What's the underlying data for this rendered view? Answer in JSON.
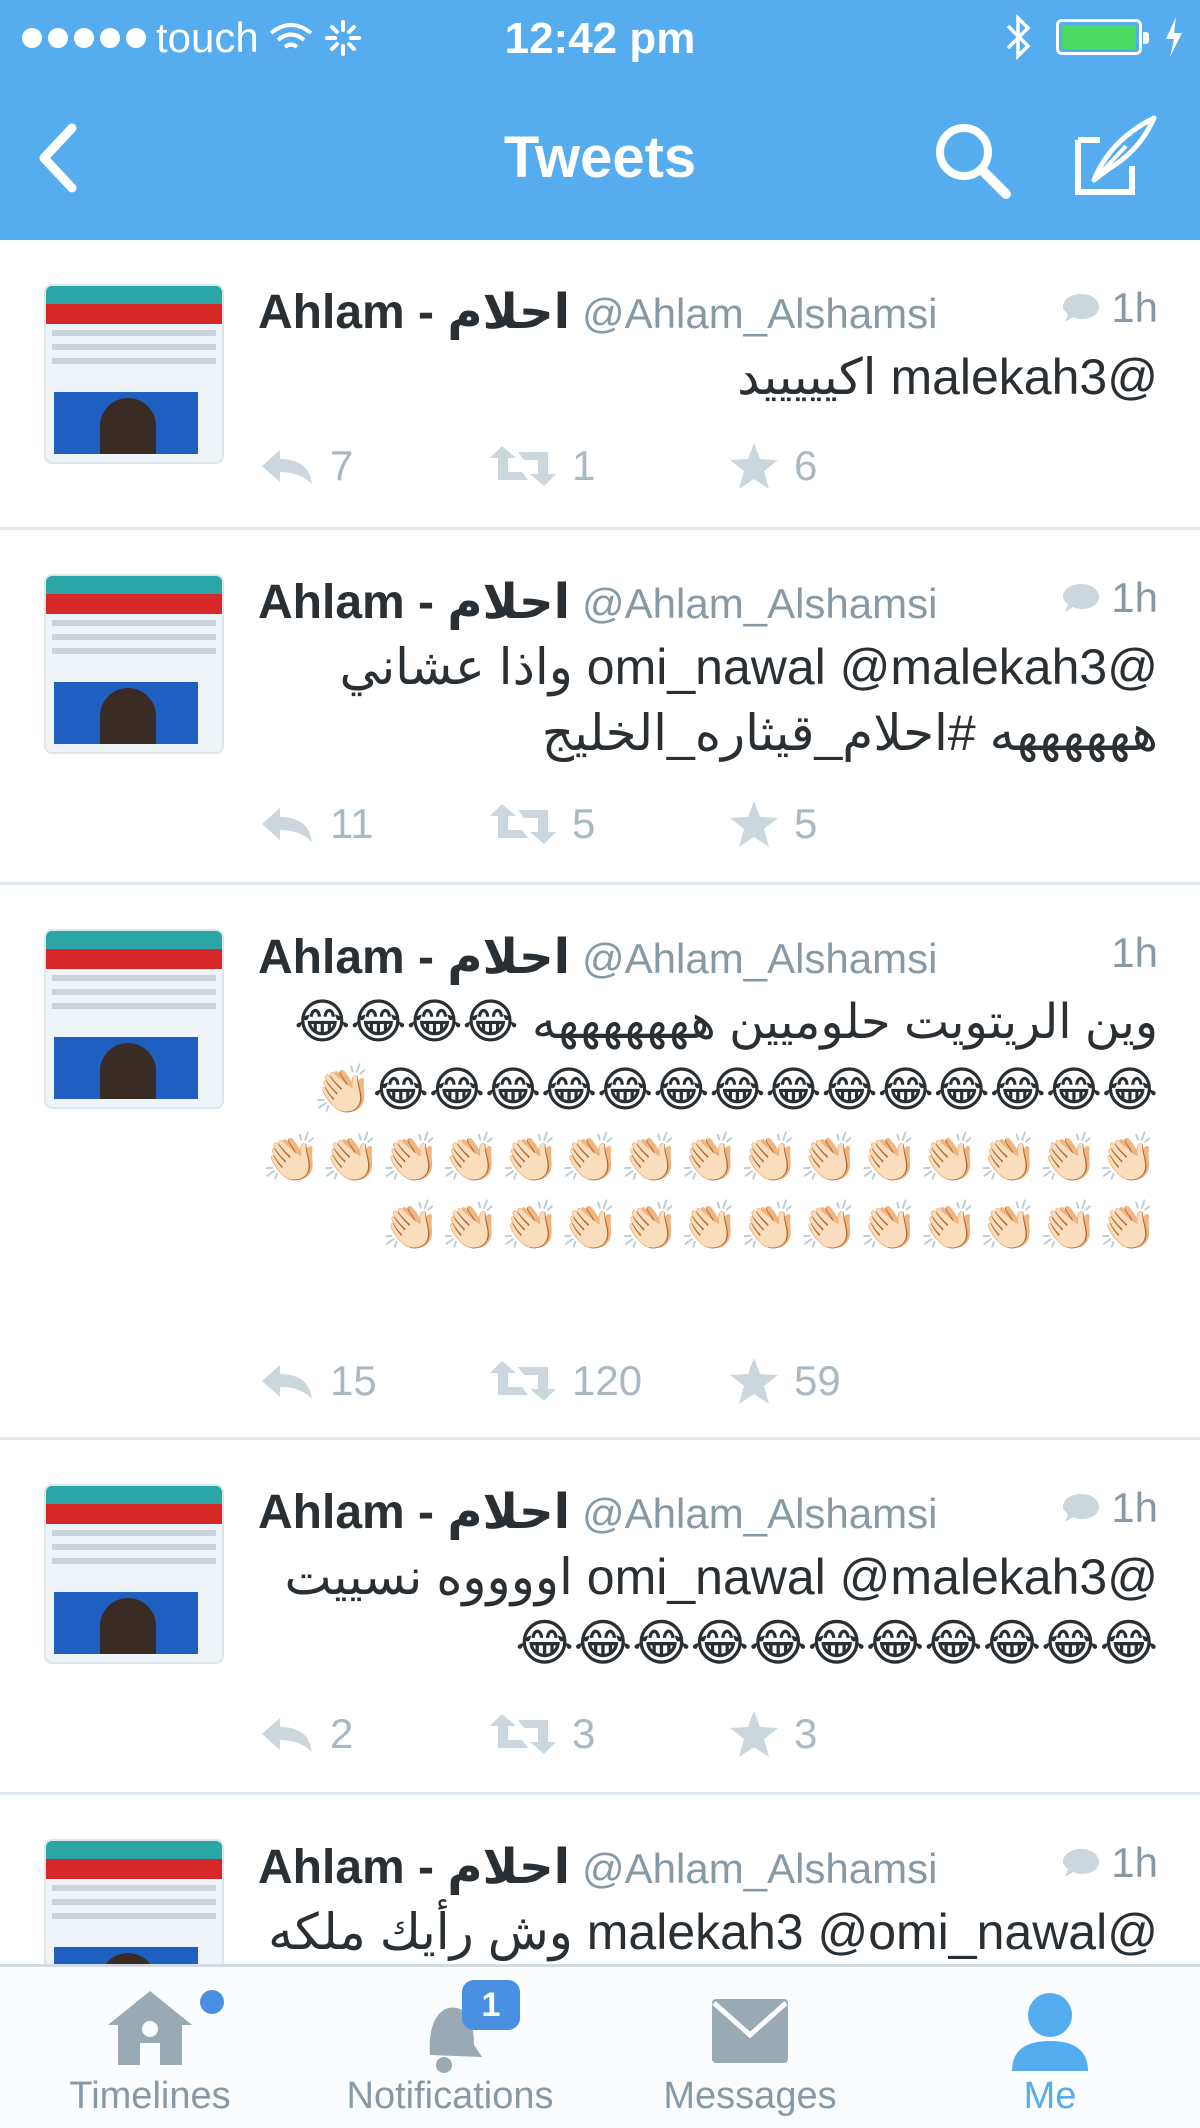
{
  "status_bar": {
    "carrier": "touch",
    "time": "12:42 pm"
  },
  "nav": {
    "title": "Tweets"
  },
  "colors": {
    "brand": "#55acee",
    "divider": "#e1e8ed",
    "muted": "#8899a6"
  },
  "tweets": [
    {
      "name": "Ahlam - احلام",
      "handle": "@Ahlam_Alshamsi",
      "time": "1h",
      "text": "@malekah3 اكيييييد",
      "replies": "7",
      "retweets": "1",
      "favorites": "6"
    },
    {
      "name": "Ahlam - احلام",
      "handle": "@Ahlam_Alshamsi",
      "time": "1h",
      "text": "@omi_nawal @malekah3 واذا عشاني ههههههه #احلام_قيثاره_الخليج",
      "replies": "11",
      "retweets": "5",
      "favorites": "5"
    },
    {
      "name": "Ahlam - احلام",
      "handle": "@Ahlam_Alshamsi",
      "time": "1h",
      "text": "وين الريتويت حلوميين هههههههه 😂😂😂😂😂😂😂😂😂😂😂😂😂😂😂😂😂😂👏🏻👏🏻👏🏻👏🏻👏🏻👏🏻👏🏻👏🏻👏🏻👏🏻👏🏻👏🏻👏🏻👏🏻👏🏻👏🏻👏🏻👏🏻👏🏻👏🏻👏🏻👏🏻👏🏻👏🏻👏🏻👏🏻👏🏻👏🏻👏🏻",
      "replies": "15",
      "retweets": "120",
      "favorites": "59"
    },
    {
      "name": "Ahlam - احلام",
      "handle": "@Ahlam_Alshamsi",
      "time": "1h",
      "text": "@omi_nawal @malekah3 اووووه نسييت 😂😂😂😂😂😂😂😂😂😂😂",
      "replies": "2",
      "retweets": "3",
      "favorites": "3"
    },
    {
      "name": "Ahlam - احلام",
      "handle": "@Ahlam_Alshamsi",
      "time": "1h",
      "text": "@malekah3 @omi_nawal وش رأيك ملكه"
    }
  ],
  "tabs": [
    {
      "label": "Timelines"
    },
    {
      "label": "Notifications",
      "badge": "1"
    },
    {
      "label": "Messages"
    },
    {
      "label": "Me"
    }
  ]
}
